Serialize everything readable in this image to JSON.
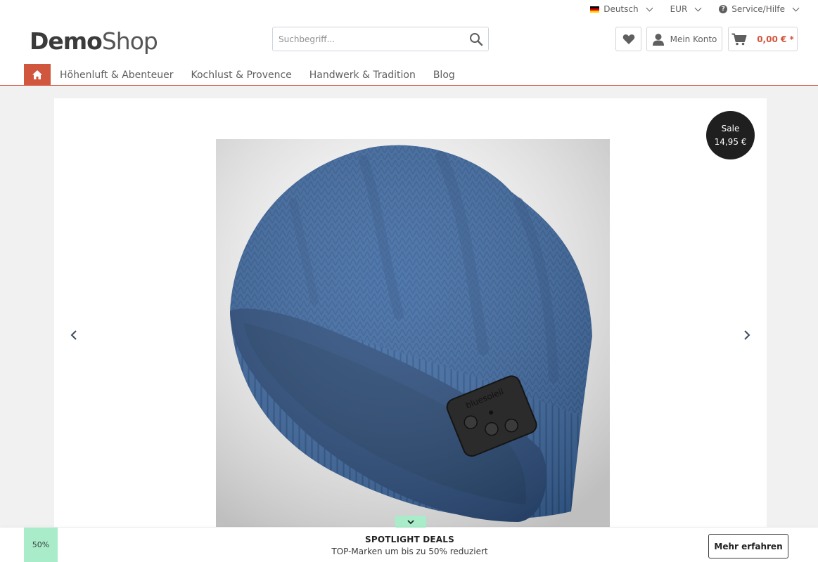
{
  "topbar": {
    "language": "Deutsch",
    "currency": "EUR",
    "service": "Service/Hilfe"
  },
  "logo": {
    "part1": "Demo",
    "part2": "Shop"
  },
  "search": {
    "placeholder": "Suchbegriff..."
  },
  "account": {
    "label": "Mein Konto"
  },
  "cart": {
    "total": "0,00 € *"
  },
  "nav": {
    "items": [
      {
        "label": "Höhenluft & Abenteuer"
      },
      {
        "label": "Kochlust & Provence"
      },
      {
        "label": "Handwerk & Tradition"
      },
      {
        "label": "Blog"
      }
    ]
  },
  "slider": {
    "badge_label": "Sale",
    "badge_price": "14,95 €",
    "product_imprint": "bluesoleil"
  },
  "bottom": {
    "percent": "50%",
    "title": "SPOTLIGHT DEALS",
    "subtitle": "TOP-Marken um bis zu 50% reduziert",
    "button": "Mehr erfahren"
  },
  "colors": {
    "accent": "#d1563e",
    "deal_green": "#a8ecc9",
    "hat_blue": "#3e6aa3"
  }
}
